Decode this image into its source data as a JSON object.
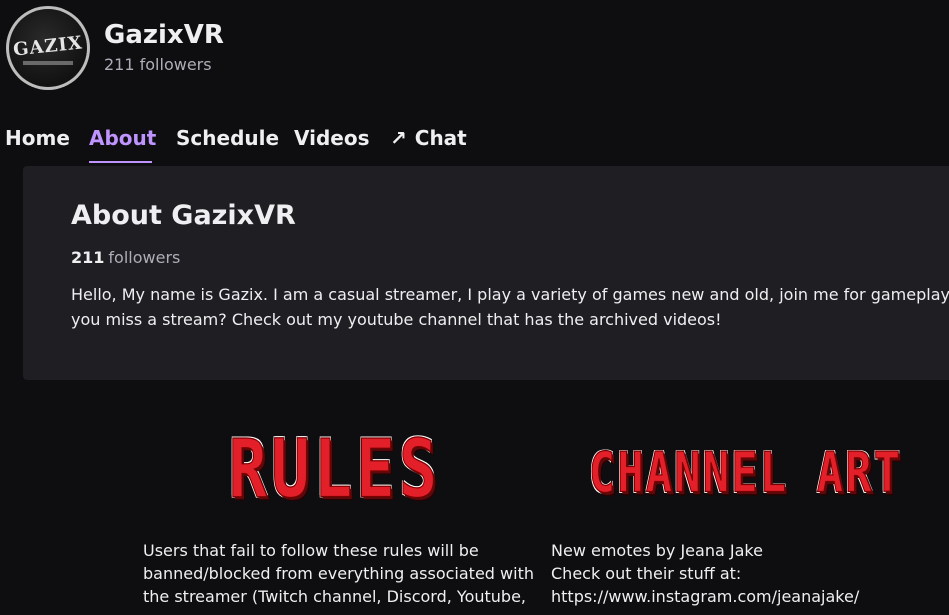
{
  "channel": {
    "name": "GazixVR",
    "followers_label": "211 followers",
    "avatar_text": "GAZIX"
  },
  "tabs": [
    {
      "label": "Home",
      "active": false
    },
    {
      "label": "About",
      "active": true
    },
    {
      "label": "Schedule",
      "active": false
    },
    {
      "label": "Videos",
      "active": false
    },
    {
      "label": "Chat",
      "active": false,
      "icon": "external-arrow-icon"
    }
  ],
  "about": {
    "title": "About GazixVR",
    "followers_count": "211",
    "followers_word": "followers",
    "bio_lines": [
      "Hello, My name is Gazix. I am a casual streamer, I play a variety of games new and old, join me for gameplay an",
      "you miss a stream? Check out my youtube channel that has the archived videos!"
    ]
  },
  "panels": [
    {
      "image_text": "RULES",
      "lines": [
        "Users that fail to follow these rules will be",
        "banned/blocked from everything associated with",
        "the streamer (Twitch channel, Discord, Youtube,"
      ]
    },
    {
      "image_text": "CHANNEL ART",
      "lines": [
        "New emotes by Jeana Jake",
        "Check out their stuff at:",
        "https://www.instagram.com/jeanajake/"
      ]
    }
  ],
  "colors": {
    "background": "#0e0e10",
    "panel": "#1f1f23",
    "accent": "#bf94ff",
    "muted": "#adadb8",
    "graffiti_red": "#e3202a"
  }
}
